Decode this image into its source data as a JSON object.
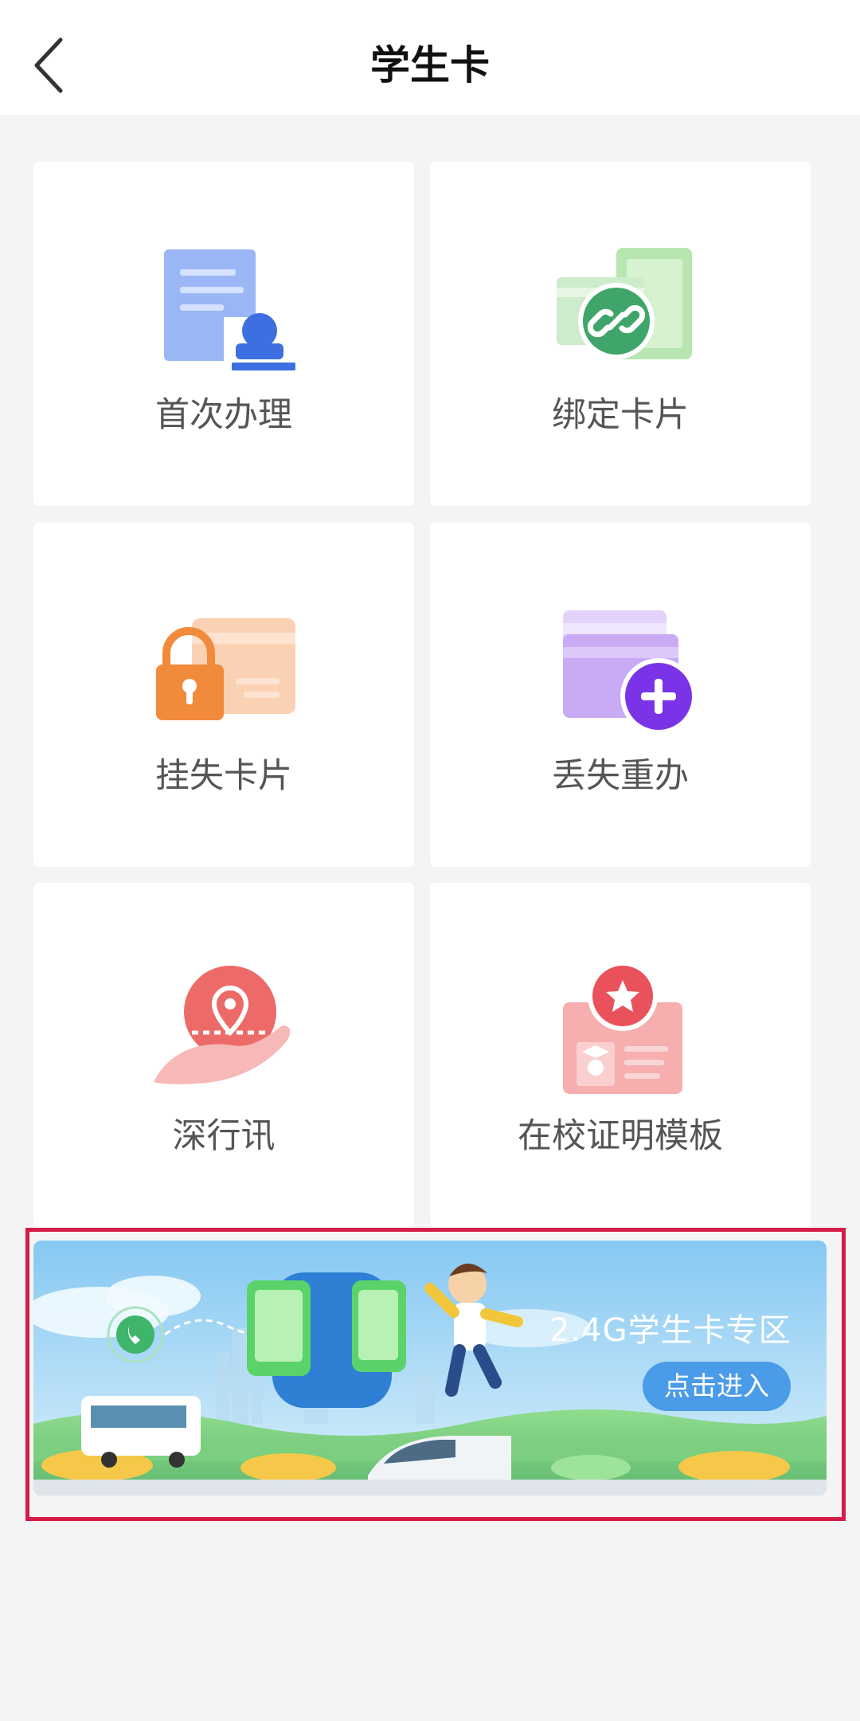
{
  "header": {
    "title": "学生卡",
    "back_icon": "chevron-left-icon"
  },
  "tiles": [
    {
      "label": "首次办理",
      "icon": "id-document-person-icon"
    },
    {
      "label": "绑定卡片",
      "icon": "link-card-icon"
    },
    {
      "label": "挂失卡片",
      "icon": "lock-card-icon"
    },
    {
      "label": "丢失重办",
      "icon": "add-card-icon"
    },
    {
      "label": "深行讯",
      "icon": "location-hand-icon"
    },
    {
      "label": "在校证明模板",
      "icon": "certificate-star-icon"
    }
  ],
  "banner": {
    "title": "2.4G学生卡专区",
    "button_label": "点击进入"
  },
  "colors": {
    "highlight_border": "#d51c47",
    "banner_button": "#4a9be8"
  }
}
